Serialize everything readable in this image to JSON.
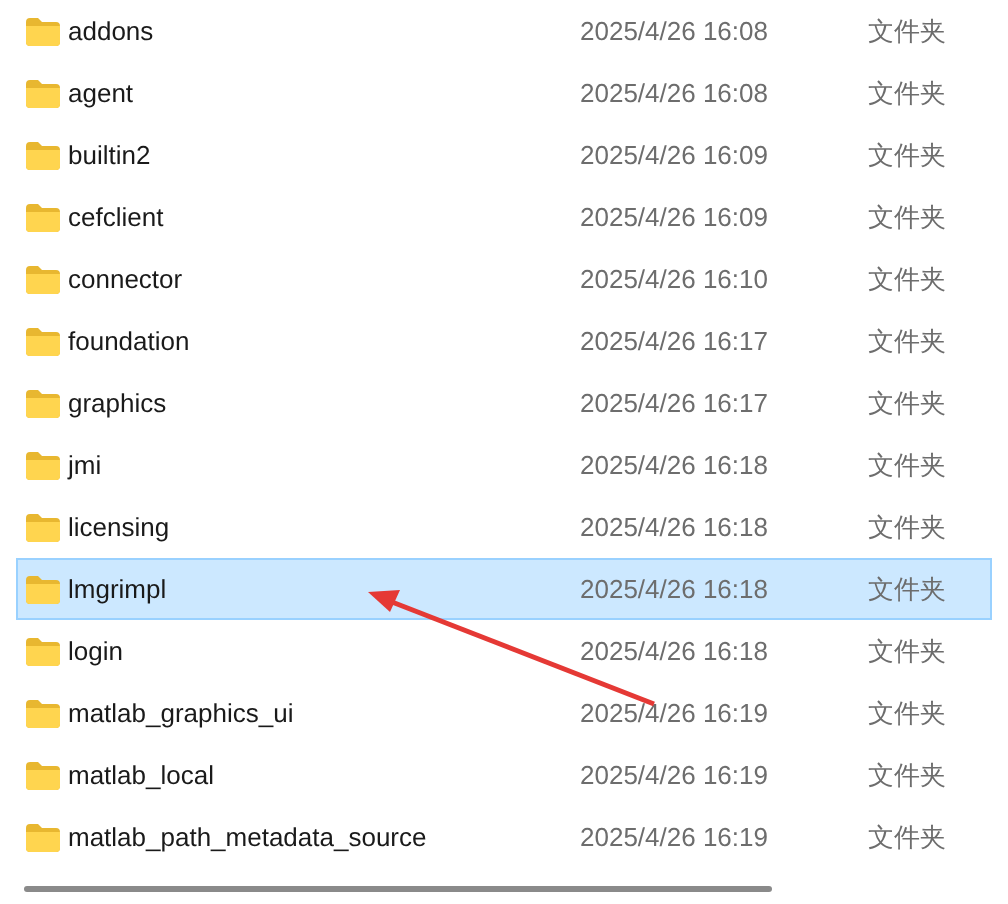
{
  "files": [
    {
      "name": "addons",
      "date": "2025/4/26 16:08",
      "type": "文件夹",
      "selected": false
    },
    {
      "name": "agent",
      "date": "2025/4/26 16:08",
      "type": "文件夹",
      "selected": false
    },
    {
      "name": "builtin2",
      "date": "2025/4/26 16:09",
      "type": "文件夹",
      "selected": false
    },
    {
      "name": "cefclient",
      "date": "2025/4/26 16:09",
      "type": "文件夹",
      "selected": false
    },
    {
      "name": "connector",
      "date": "2025/4/26 16:10",
      "type": "文件夹",
      "selected": false
    },
    {
      "name": "foundation",
      "date": "2025/4/26 16:17",
      "type": "文件夹",
      "selected": false
    },
    {
      "name": "graphics",
      "date": "2025/4/26 16:17",
      "type": "文件夹",
      "selected": false
    },
    {
      "name": "jmi",
      "date": "2025/4/26 16:18",
      "type": "文件夹",
      "selected": false
    },
    {
      "name": "licensing",
      "date": "2025/4/26 16:18",
      "type": "文件夹",
      "selected": false
    },
    {
      "name": "lmgrimpl",
      "date": "2025/4/26 16:18",
      "type": "文件夹",
      "selected": true
    },
    {
      "name": "login",
      "date": "2025/4/26 16:18",
      "type": "文件夹",
      "selected": false
    },
    {
      "name": "matlab_graphics_ui",
      "date": "2025/4/26 16:19",
      "type": "文件夹",
      "selected": false
    },
    {
      "name": "matlab_local",
      "date": "2025/4/26 16:19",
      "type": "文件夹",
      "selected": false
    },
    {
      "name": "matlab_path_metadata_source",
      "date": "2025/4/26 16:19",
      "type": "文件夹",
      "selected": false
    }
  ]
}
